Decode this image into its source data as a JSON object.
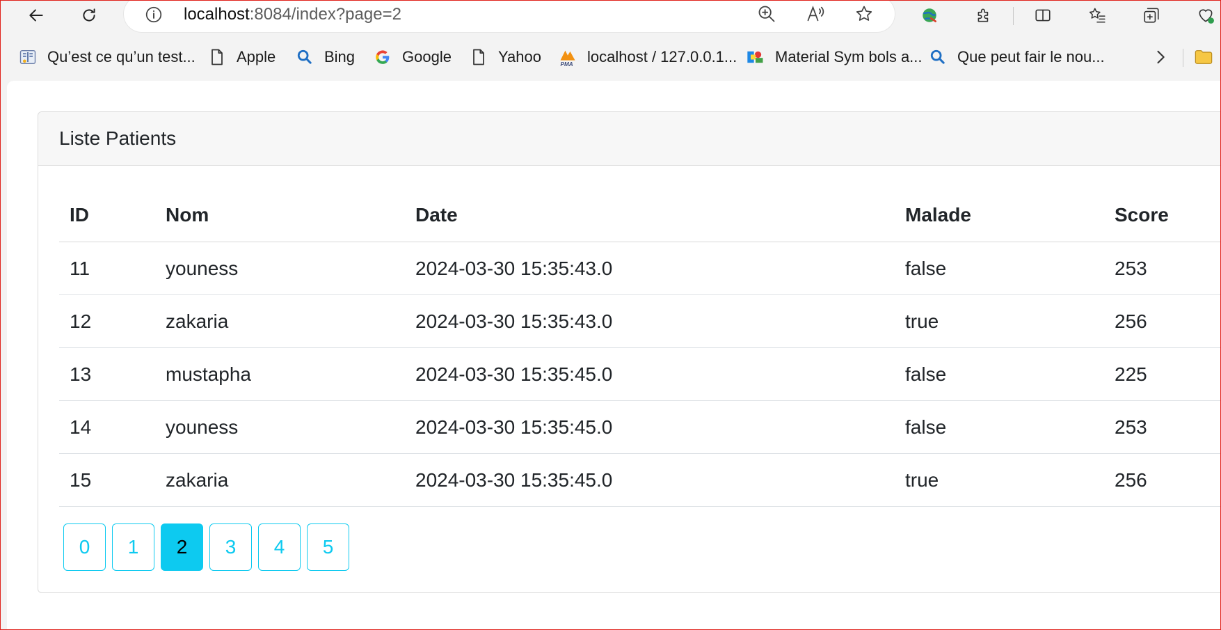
{
  "browser": {
    "url_host": "localhost",
    "url_rest": ":8084/index?page=2",
    "bookmarks": [
      {
        "label": "Qu’est ce qu’un test...",
        "icon": "book-icon"
      },
      {
        "label": "Apple",
        "icon": "page-icon"
      },
      {
        "label": "Bing",
        "icon": "search-icon"
      },
      {
        "label": "Google",
        "icon": "google-icon"
      },
      {
        "label": "Yahoo",
        "icon": "page-icon"
      },
      {
        "label": "localhost / 127.0.0.1...",
        "icon": "pma-icon"
      },
      {
        "label": "Material Sym bols a...",
        "icon": "material-icon"
      },
      {
        "label": "Que peut fair le nou...",
        "icon": "search-icon"
      }
    ]
  },
  "card": {
    "title": "Liste Patients"
  },
  "table": {
    "headers": [
      "ID",
      "Nom",
      "Date",
      "Malade",
      "Score"
    ],
    "rows": [
      [
        "11",
        "youness",
        "2024-03-30 15:35:43.0",
        "false",
        "253"
      ],
      [
        "12",
        "zakaria",
        "2024-03-30 15:35:43.0",
        "true",
        "256"
      ],
      [
        "13",
        "mustapha",
        "2024-03-30 15:35:45.0",
        "false",
        "225"
      ],
      [
        "14",
        "youness",
        "2024-03-30 15:35:45.0",
        "false",
        "253"
      ],
      [
        "15",
        "zakaria",
        "2024-03-30 15:35:45.0",
        "true",
        "256"
      ]
    ]
  },
  "pagination": {
    "pages": [
      "0",
      "1",
      "2",
      "3",
      "4",
      "5"
    ],
    "current": "2"
  },
  "colors": {
    "accent": "#0dcaf0",
    "frame": "#e0201a"
  }
}
